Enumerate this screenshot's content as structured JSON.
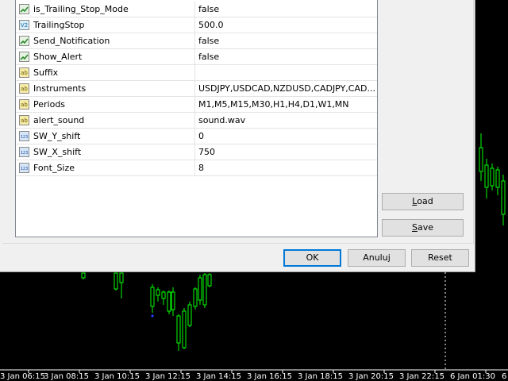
{
  "parameters": [
    {
      "name": "is_Trailing_Stop_Mode",
      "value": "false",
      "icon": "bool-icon"
    },
    {
      "name": "TrailingStop",
      "value": "500.0",
      "icon": "double-icon"
    },
    {
      "name": "Send_Notification",
      "value": "false",
      "icon": "bool-icon"
    },
    {
      "name": "Show_Alert",
      "value": "false",
      "icon": "bool-icon"
    },
    {
      "name": "Suffix",
      "value": "",
      "icon": "string-icon"
    },
    {
      "name": "Instruments",
      "value": "USDJPY,USDCAD,NZDUSD,CADJPY,CAD...",
      "icon": "string-icon"
    },
    {
      "name": "Periods",
      "value": "M1,M5,M15,M30,H1,H4,D1,W1,MN",
      "icon": "string-icon"
    },
    {
      "name": "alert_sound",
      "value": "sound.wav",
      "icon": "string-icon"
    },
    {
      "name": "SW_Y_shift",
      "value": "0",
      "icon": "int-icon"
    },
    {
      "name": "SW_X_shift",
      "value": "750",
      "icon": "int-icon"
    },
    {
      "name": "Font_Size",
      "value": "8",
      "icon": "int-icon"
    }
  ],
  "icons": {
    "bool-icon": {
      "glyph": "",
      "bg": "#e6f3e3",
      "fg": "#2e8b2e"
    },
    "double-icon": {
      "glyph": "V2",
      "bg": "#d6ecf7",
      "fg": "#1b6aa5"
    },
    "string-icon": {
      "glyph": "ab",
      "bg": "#f6eaa7",
      "fg": "#6b5a00"
    },
    "int-icon": {
      "glyph": "123",
      "bg": "#d6e6f7",
      "fg": "#1b4fa5"
    }
  },
  "buttons": {
    "load": {
      "prefix": "",
      "underlined": "L",
      "rest": "oad"
    },
    "save": {
      "prefix": "",
      "underlined": "S",
      "rest": "ave"
    },
    "ok": "OK",
    "cancel": "Anuluj",
    "reset": "Reset"
  },
  "time_axis": [
    "3 Jan 06:15",
    "3 Jan 08:15",
    "3 Jan 10:15",
    "3 Jan 12:15",
    "3 Jan 14:15",
    "3 Jan 16:15",
    "3 Jan 18:15",
    "3 Jan 20:15",
    "3 Jan 22:15",
    "6 Jan 01:30",
    "6"
  ],
  "colors": {
    "bull_candle": "#00ff00",
    "bear_candle": "#ffffff",
    "period_separator": "#ffffff"
  }
}
